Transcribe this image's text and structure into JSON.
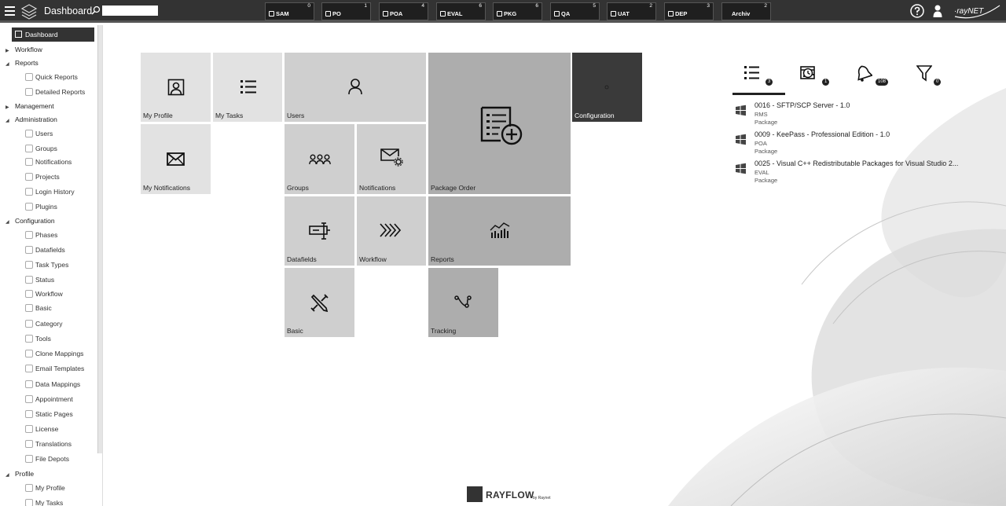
{
  "header": {
    "title": "Dashboard",
    "search_placeholder": ""
  },
  "phases": [
    {
      "label": "SAM",
      "count": "0"
    },
    {
      "label": "PO",
      "count": "1"
    },
    {
      "label": "POA",
      "count": "4"
    },
    {
      "label": "EVAL",
      "count": "6"
    },
    {
      "label": "PKG",
      "count": "6"
    },
    {
      "label": "QA",
      "count": "5"
    },
    {
      "label": "UAT",
      "count": "2"
    },
    {
      "label": "DEP",
      "count": "3"
    },
    {
      "label": "Archiv",
      "count": "2"
    }
  ],
  "brand": {
    "logo_text": "·rayNET",
    "footer_name": "RAYFLOW",
    "footer_by": "by Raynet"
  },
  "sidebar": {
    "dashboard": "Dashboard",
    "groups": [
      {
        "label": "Workflow"
      },
      {
        "label": "Reports"
      },
      {
        "label": "Management"
      },
      {
        "label": "Administration"
      },
      {
        "label": "Configuration"
      },
      {
        "label": "Profile"
      }
    ],
    "reports_items": [
      "Quick Reports",
      "Detailed Reports"
    ],
    "administration_items": [
      "Users",
      "Groups",
      "Notifications",
      "Projects",
      "Login History",
      "Plugins"
    ],
    "configuration_items": [
      "Phases",
      "Datafields",
      "Task Types",
      "Status",
      "Workflow",
      "Basic",
      "Category",
      "Tools",
      "Clone Mappings",
      "Email Templates",
      "Data Mappings",
      "Appointment",
      "Static Pages",
      "License",
      "Translations",
      "File Depots"
    ],
    "profile_items": [
      "My Profile",
      "My Tasks"
    ]
  },
  "tiles": {
    "my_profile": "My Profile",
    "my_tasks": "My Tasks",
    "users": "Users",
    "package_order": "Package Order",
    "configuration": "Configuration",
    "my_notifications": "My Notifications",
    "groups": "Groups",
    "notifications": "Notifications",
    "datafields": "Datafields",
    "workflow": "Workflow",
    "reports": "Reports",
    "basic": "Basic",
    "tracking": "Tracking"
  },
  "right_panel": {
    "tabs": [
      {
        "icon": "task-list-icon",
        "badge": "3"
      },
      {
        "icon": "calendar-clock-icon",
        "badge": "1"
      },
      {
        "icon": "bell-icon",
        "badge": "108"
      },
      {
        "icon": "filter-icon",
        "badge": "0"
      }
    ],
    "tasks": [
      {
        "title": "0016 - SFTP/SCP Server - 1.0",
        "phase": "RMS",
        "type": "Package"
      },
      {
        "title": "0009 - KeePass - Professional Edition - 1.0",
        "phase": "POA",
        "type": "Package"
      },
      {
        "title": "0025 - Visual C++ Redistributable Packages for Visual Studio 2...",
        "phase": "EVAL",
        "type": "Package"
      }
    ]
  }
}
